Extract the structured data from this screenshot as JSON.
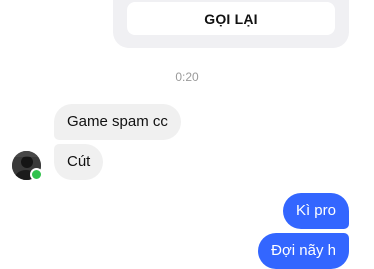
{
  "call": {
    "button_label": "GỌI LẠI"
  },
  "timestamp": "0:20",
  "messages": [
    {
      "side": "incoming",
      "text": "Game spam cc"
    },
    {
      "side": "incoming",
      "text": "Cút"
    },
    {
      "side": "outgoing",
      "text": "Kì pro"
    },
    {
      "side": "outgoing",
      "text": "Đợi nãy h"
    }
  ],
  "colors": {
    "outgoing_bubble": "#3366ff",
    "incoming_bubble": "#f0f0f0",
    "online_dot": "#31c24d"
  },
  "icons": {
    "avatar": "user-avatar",
    "presence": "online-dot"
  }
}
